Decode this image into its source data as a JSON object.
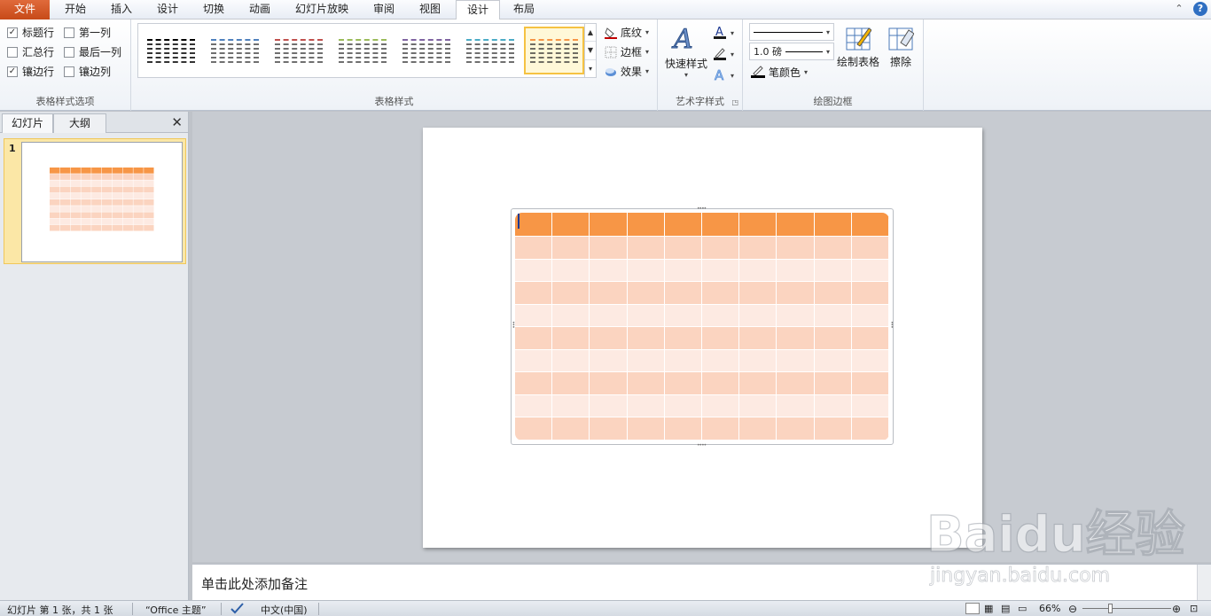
{
  "tabs": [
    "文件",
    "开始",
    "插入",
    "设计",
    "切换",
    "动画",
    "幻灯片放映",
    "审阅",
    "视图",
    "设计",
    "布局"
  ],
  "active_tab_index": 9,
  "table_style_options": {
    "group_label": "表格样式选项",
    "items": [
      {
        "label": "标题行",
        "checked": true
      },
      {
        "label": "第一列",
        "checked": false
      },
      {
        "label": "汇总行",
        "checked": false
      },
      {
        "label": "最后一列",
        "checked": false
      },
      {
        "label": "镶边行",
        "checked": true
      },
      {
        "label": "镶边列",
        "checked": false
      }
    ]
  },
  "table_styles": {
    "group_label": "表格样式",
    "swatch_colors": [
      "#000000",
      "#4f81bd",
      "#c0504d",
      "#9bbb59",
      "#8064a2",
      "#4bacc6",
      "#f79646"
    ],
    "selected_index": 6,
    "shading_label": "底纹",
    "borders_label": "边框",
    "effects_label": "效果"
  },
  "wordart": {
    "group_label": "艺术字样式",
    "quick_styles_label": "快速样式"
  },
  "draw_borders": {
    "group_label": "绘图边框",
    "pen_weight": "1.0 磅",
    "pen_color_label": "笔颜色",
    "draw_table_label": "绘制表格",
    "eraser_label": "擦除"
  },
  "left_pane": {
    "tab_slides": "幻灯片",
    "tab_outline": "大纲",
    "slide_number": "1"
  },
  "notes": {
    "placeholder": "单击此处添加备注"
  },
  "status": {
    "slide_info": "幻灯片 第 1 张，共 1 张",
    "theme": "“Office 主题”",
    "language": "中文(中国)",
    "zoom": "66%"
  },
  "watermark": {
    "brand": "Baidu经验",
    "url": "jingyan.baidu.com"
  },
  "colors": {
    "file_tab": "#d0561f",
    "table_header": "#f79646",
    "band_dark": "#fbd4c0",
    "band_light": "#fdeae2"
  }
}
